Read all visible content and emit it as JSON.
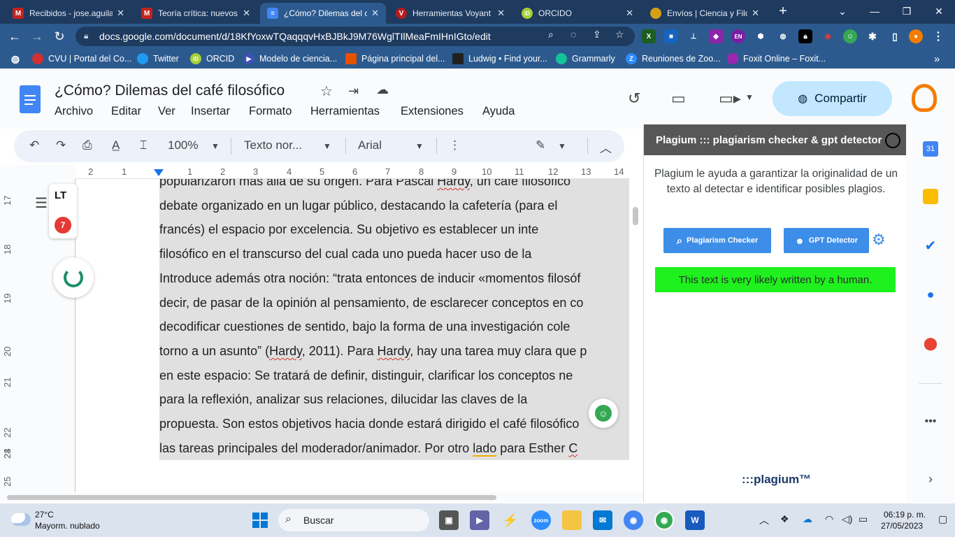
{
  "browser": {
    "tabs": [
      {
        "label": "Recibidos - jose.aguila",
        "color": "#c5221f",
        "glyph": "M"
      },
      {
        "label": "Teoría crítica: nuevos r",
        "color": "#c5221f",
        "glyph": "M"
      },
      {
        "label": "¿Cómo? Dilemas del c",
        "color": "#4285f4",
        "glyph": "≡"
      },
      {
        "label": "Herramientas Voyant",
        "color": "#b71c1c",
        "glyph": "V"
      },
      {
        "label": "ORCIDO",
        "color": "#a6ce39",
        "glyph": "iD"
      },
      {
        "label": "Envíos | Ciencia y Filos",
        "color": "#d4a017",
        "glyph": "●"
      }
    ],
    "new_tab": "+",
    "url": "docs.google.com/document/d/18KfYoxwTQaqqqvHxBJBkJ9M76WglTIlMeaFmIHnIGto/edit",
    "bookmarks": [
      {
        "label": "CVU | Portal del Co...",
        "color": "#d32f2f"
      },
      {
        "label": "Twitter",
        "color": "#1d9bf0"
      },
      {
        "label": "ORCID",
        "color": "#a6ce39"
      },
      {
        "label": "Modelo de ciencia...",
        "color": "#3f51b5"
      },
      {
        "label": "Página principal del...",
        "color": "#e65100"
      },
      {
        "label": "Ludwig • Find your...",
        "color": "#212121"
      },
      {
        "label": "Grammarly",
        "color": "#15c39a"
      },
      {
        "label": "Reuniones de Zoo...",
        "color": "#2d8cff"
      },
      {
        "label": "Foxit Online – Foxit...",
        "color": "#9c27b0"
      }
    ]
  },
  "docs": {
    "title": "¿Cómo? Dilemas del café filosófico",
    "menu": [
      "Archivo",
      "Editar",
      "Ver",
      "Insertar",
      "Formato",
      "Herramientas",
      "Extensiones",
      "Ayuda"
    ],
    "share_label": "Compartir",
    "toolbar": {
      "zoom": "100%",
      "style": "Texto nor...",
      "font": "Arial"
    },
    "ruler_h": [
      "2",
      "1",
      "1",
      "2",
      "3",
      "4",
      "5",
      "6",
      "7",
      "8",
      "9",
      "10",
      "11",
      "12",
      "13",
      "14"
    ],
    "ruler_v": [
      "17",
      "18",
      "19",
      "20",
      "21",
      "22",
      "23",
      "24",
      "25"
    ],
    "lt_badge": "7",
    "lines": [
      [
        {
          "t": "popularizaron más allá de su origen. Para Pascal "
        },
        {
          "t": "Hardy",
          "s": "spell"
        },
        {
          "t": ", un café filosófico"
        }
      ],
      [
        {
          "t": "debate organizado en un lugar público, destacando la cafetería (para el"
        }
      ],
      [
        {
          "t": "francés) el espacio por excelencia. Su objetivo es establecer un inte"
        }
      ],
      [
        {
          "t": "filosófico en el transcurso del cual cada uno pueda hacer uso de la"
        }
      ],
      [
        {
          "t": "Introduce además otra noción: “trata entonces de inducir «momentos filosóf"
        }
      ],
      [
        {
          "t": "decir, de pasar de la opinión al pensamiento, de esclarecer conceptos en co"
        }
      ],
      [
        {
          "t": "decodificar cuestiones de sentido, bajo la forma de una investigación cole"
        }
      ],
      [
        {
          "t": "torno a un asunto” ("
        },
        {
          "t": "Hardy",
          "s": "spell"
        },
        {
          "t": ", 2011). Para "
        },
        {
          "t": "Hardy",
          "s": "spell"
        },
        {
          "t": ", hay una tarea muy clara que p"
        }
      ],
      [
        {
          "t": "en este espacio: Se tratará de definir, distinguir, clarificar los conceptos ne"
        }
      ],
      [
        {
          "t": "para la reflexión, analizar sus relaciones, dilucidar las claves de la"
        }
      ],
      [
        {
          "t": "propuesta. Son estos objetivos hacia donde estará dirigido el café filosófico"
        }
      ],
      [
        {
          "t": "las tareas principales del moderador/animador. Por otro "
        },
        {
          "t": "lado",
          "s": "gram"
        },
        {
          "t": " para  Esther "
        },
        {
          "t": "C",
          "s": "spell"
        }
      ]
    ]
  },
  "plagium": {
    "header": "Plagium ::: plagiarism checker & gpt detector",
    "description": "Plagium le ayuda a garantizar la originalidad de un texto al detectar e identificar posibles plagios.",
    "btn_plagiarism": "Plagiarism Checker",
    "btn_gpt": "GPT Detector",
    "result": "This text is very likely written by a human.",
    "logo": ":::plagium™"
  },
  "taskbar": {
    "temp": "27°C",
    "weather": "Mayorm. nublado",
    "search": "Buscar",
    "time": "06:19 p. m.",
    "date": "27/05/2023"
  }
}
